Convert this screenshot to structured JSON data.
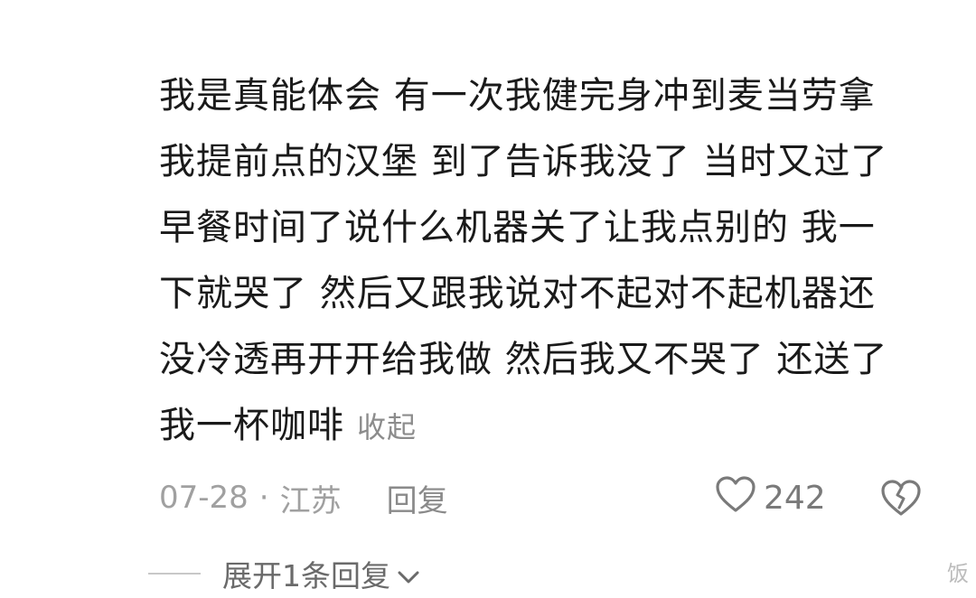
{
  "comment": {
    "lines": [
      "我是真能体会 有一次我健完身冲到麦当劳拿",
      "我提前点的汉堡 到了告诉我没了 当时又过了",
      "早餐时间了说什么机器关了让我点别的 我一",
      "下就哭了 然后又跟我说对不起对不起机器还",
      "没冷透再开开给我做 然后我又不哭了 还送了",
      "我一杯咖啡"
    ],
    "collapse_label": "收起"
  },
  "meta": {
    "date": "07-28",
    "separator": "·",
    "location": "江苏",
    "reply_label": "回复",
    "like_count": "242",
    "like_icon": "heart-outline-icon",
    "dislike_icon": "broken-heart-icon"
  },
  "replies": {
    "expand_label": "展开1条回复",
    "chevron_icon": "chevron-down-icon"
  },
  "watermark": {
    "text": "饭"
  },
  "colors": {
    "text_primary": "#1a1a1a",
    "text_secondary": "#a0a0a0",
    "icon": "#7a7a7a"
  }
}
